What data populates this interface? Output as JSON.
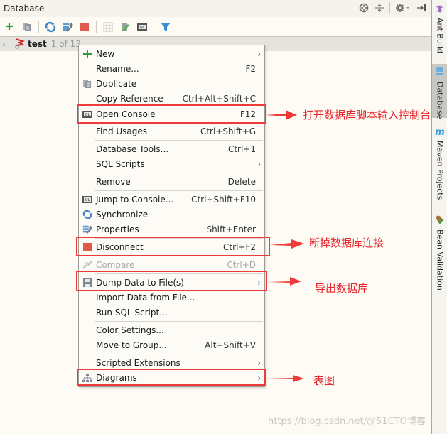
{
  "panel": {
    "title": "Database",
    "title_tools": [
      "crosshair-icon",
      "collapse-icon",
      "gear-dropdown-icon",
      "hide-panel-icon"
    ]
  },
  "toolbar": {
    "buttons": [
      {
        "name": "add-icon",
        "tooltip": "New"
      },
      {
        "name": "duplicate-icon",
        "tooltip": "Duplicate"
      },
      {
        "name": "synchronize-icon",
        "tooltip": "Synchronize"
      },
      {
        "name": "properties-icon",
        "tooltip": "Properties"
      },
      {
        "name": "disconnect-icon",
        "tooltip": "Disconnect"
      },
      {
        "name": "table-editor-icon",
        "tooltip": "Table"
      },
      {
        "name": "edit-source-icon",
        "tooltip": "Edit Source"
      },
      {
        "name": "console-icon",
        "tooltip": "Console"
      },
      {
        "name": "filter-icon",
        "tooltip": "Filter"
      }
    ]
  },
  "tree": {
    "node_name": "test",
    "node_count": "1 of 13"
  },
  "right_strip": {
    "tabs": [
      {
        "label": "Ant Build",
        "icon": "ant-icon",
        "active": false
      },
      {
        "label": "Database",
        "icon": "database-icon",
        "active": true
      },
      {
        "label": "Maven Projects",
        "icon": "maven-icon",
        "active": false
      },
      {
        "label": "Bean Validation",
        "icon": "bean-validation-icon",
        "active": false
      }
    ]
  },
  "menu": {
    "items": [
      {
        "label": "New",
        "shortcut": "",
        "submenu": true,
        "icon": "plus-icon"
      },
      {
        "label": "Rename...",
        "shortcut": "F2",
        "submenu": false,
        "icon": ""
      },
      {
        "label": "Duplicate",
        "shortcut": "",
        "submenu": false,
        "icon": "duplicate-icon"
      },
      {
        "label": "Copy Reference",
        "shortcut": "Ctrl+Alt+Shift+C",
        "submenu": false,
        "icon": ""
      },
      {
        "label": "Open Console",
        "shortcut": "F12",
        "submenu": false,
        "icon": "console-icon"
      },
      {
        "label": "Find Usages",
        "shortcut": "Ctrl+Shift+G",
        "submenu": false,
        "icon": ""
      },
      {
        "label": "Database Tools...",
        "shortcut": "Ctrl+1",
        "submenu": false,
        "icon": ""
      },
      {
        "label": "SQL Scripts",
        "shortcut": "",
        "submenu": true,
        "icon": ""
      },
      {
        "label": "Remove",
        "shortcut": "Delete",
        "submenu": false,
        "icon": ""
      },
      {
        "label": "Jump to Console...",
        "shortcut": "Ctrl+Shift+F10",
        "submenu": false,
        "icon": "console-icon"
      },
      {
        "label": "Synchronize",
        "shortcut": "",
        "submenu": false,
        "icon": "synchronize-icon"
      },
      {
        "label": "Properties",
        "shortcut": "Shift+Enter",
        "submenu": false,
        "icon": "properties-icon"
      },
      {
        "label": "Disconnect",
        "shortcut": "Ctrl+F2",
        "submenu": false,
        "icon": "stop-icon"
      },
      {
        "label": "Compare",
        "shortcut": "Ctrl+D",
        "submenu": false,
        "icon": "compare-icon",
        "disabled": true
      },
      {
        "label": "Dump Data to File(s)",
        "shortcut": "",
        "submenu": true,
        "icon": "save-icon"
      },
      {
        "label": "Import Data from File...",
        "shortcut": "",
        "submenu": false,
        "icon": ""
      },
      {
        "label": "Run SQL Script...",
        "shortcut": "",
        "submenu": false,
        "icon": ""
      },
      {
        "label": "Color Settings...",
        "shortcut": "",
        "submenu": false,
        "icon": ""
      },
      {
        "label": "Move to Group...",
        "shortcut": "Alt+Shift+V",
        "submenu": false,
        "icon": ""
      },
      {
        "label": "Scripted Extensions",
        "shortcut": "",
        "submenu": true,
        "icon": ""
      },
      {
        "label": "Diagrams",
        "shortcut": "",
        "submenu": true,
        "icon": "diagram-icon"
      }
    ],
    "submenu_arrow": "›"
  },
  "annotations": [
    {
      "target": "Open Console",
      "note": "打开数据库脚本输入控制台"
    },
    {
      "target": "Disconnect",
      "note": "断掉数据库连接"
    },
    {
      "target": "Dump Data to File(s)",
      "note": "导出数据库"
    },
    {
      "target": "Diagrams",
      "note": "表图"
    }
  ],
  "watermark": "https://blog.csdn.net/@51CTO博客",
  "colors": {
    "highlight_red": "#ef3a3a",
    "annotation_text": "#e8262b",
    "menu_bg": "#fdfbf5",
    "panel_bg": "#fdfbf4"
  }
}
